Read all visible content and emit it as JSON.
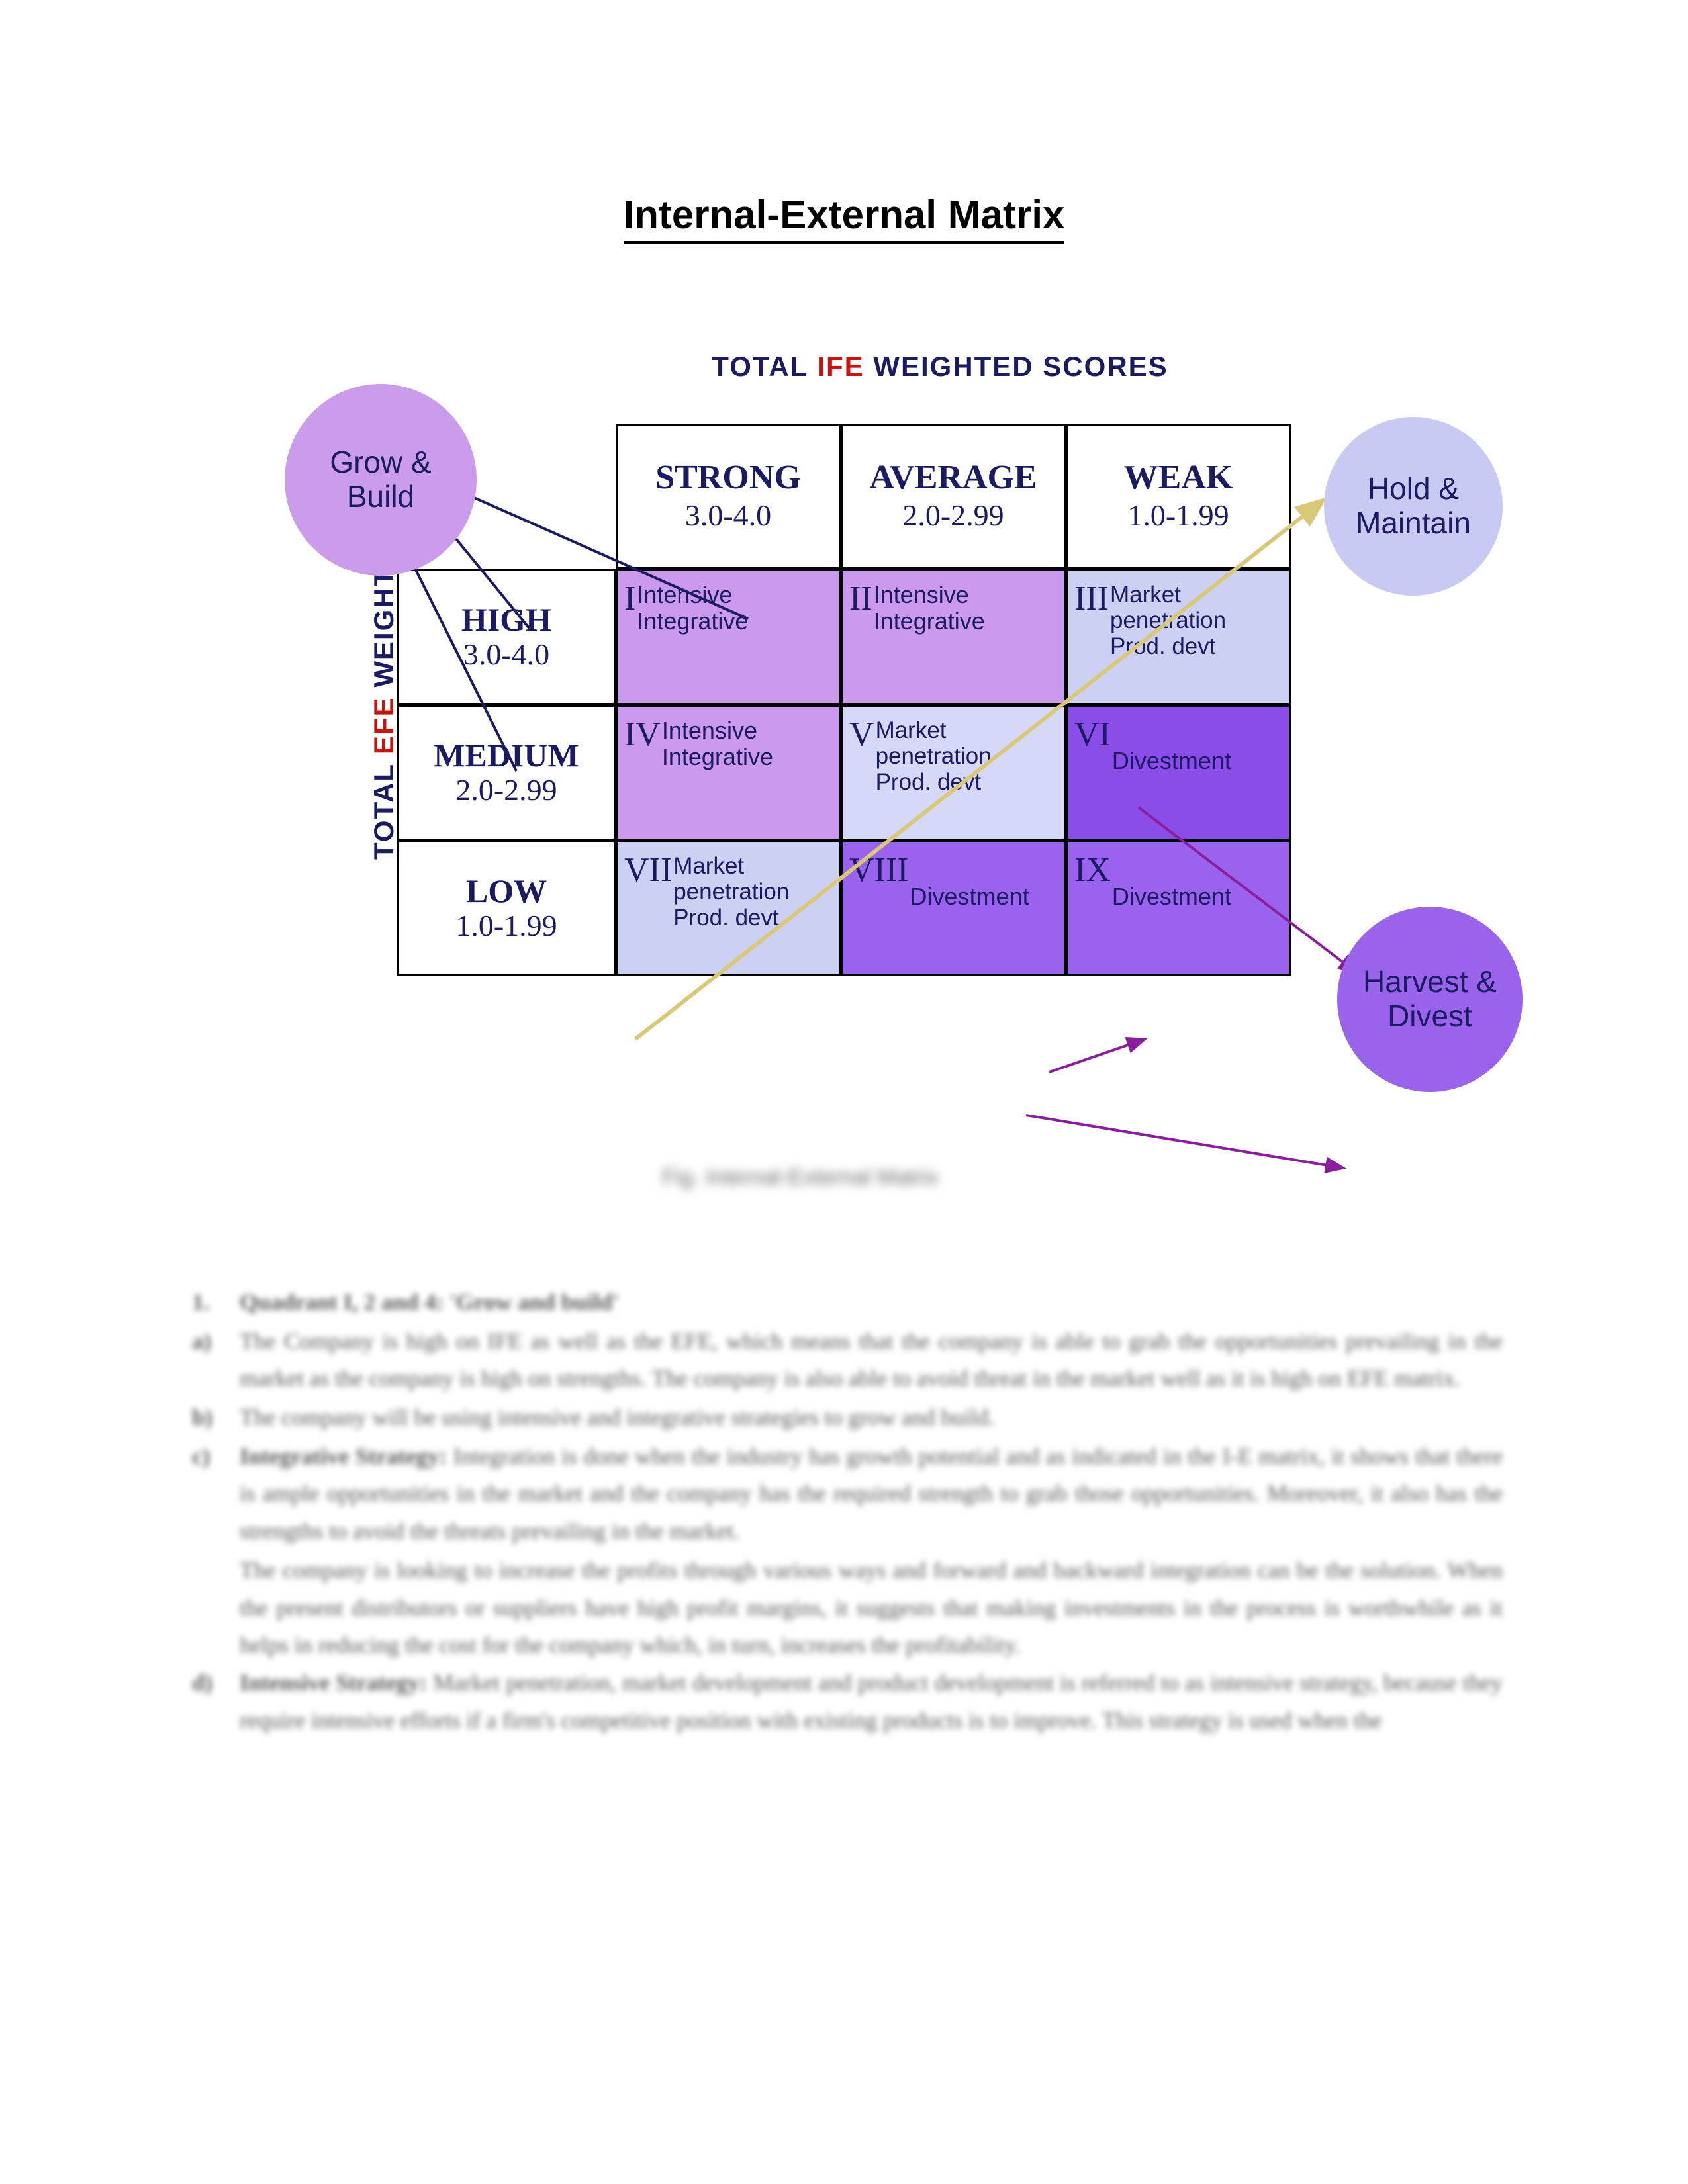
{
  "document": {
    "title": "Internal-External Matrix"
  },
  "figure": {
    "x_axis_label": {
      "prefix": "TOTAL ",
      "highlight": "IFE",
      "suffix": " WEIGHTED SCORES",
      "highlight_color": "#cc1111",
      "text_color": "#1b1b63"
    },
    "y_axis_label": {
      "prefix": "TOTAL ",
      "highlight": "EFE",
      "suffix": " WEIGHTED SCORES",
      "highlight_color": "#cc1111",
      "text_color": "#1b1b63"
    },
    "caption": "Fig. Internal-External Matrix",
    "columns": [
      {
        "name": "STRONG",
        "range": "3.0-4.0"
      },
      {
        "name": "AVERAGE",
        "range": "2.0-2.99"
      },
      {
        "name": "WEAK",
        "range": "1.0-1.99"
      }
    ],
    "rows": [
      {
        "name": "HIGH",
        "range": "3.0-4.0"
      },
      {
        "name": "MEDIUM",
        "range": "2.0-2.99"
      },
      {
        "name": "LOW",
        "range": "1.0-1.99"
      }
    ],
    "cells": [
      {
        "numeral": "I",
        "strategy": "Intensive\nIntegrative",
        "color": "#cc99f0"
      },
      {
        "numeral": "II",
        "strategy": "Intensive\nIntegrative",
        "color": "#cc99f0"
      },
      {
        "numeral": "III",
        "strategy": "Market\npenetration\nProd. devt",
        "color": "#ccd0f2"
      },
      {
        "numeral": "IV",
        "strategy": "Intensive\nIntegrative",
        "color": "#cc99f0"
      },
      {
        "numeral": "V",
        "strategy": "Market\npenetration\nProd. devt",
        "color": "#d5d8f7"
      },
      {
        "numeral": "VI",
        "strategy": "Divestment",
        "color": "#8b4dea"
      },
      {
        "numeral": "VII",
        "strategy": "Market\npenetration\nProd. devt",
        "color": "#ccd0f2"
      },
      {
        "numeral": "VIII",
        "strategy": "Divestment",
        "color": "#9a63ee"
      },
      {
        "numeral": "IX",
        "strategy": "Divestment",
        "color": "#9a63ee"
      }
    ],
    "circles": [
      {
        "id": "grow",
        "label": "Grow &\nBuild",
        "color": "#cb9cec"
      },
      {
        "id": "hold",
        "label": "Hold &\nMaintain",
        "color": "#c9caf3"
      },
      {
        "id": "harvest",
        "label": "Harvest &\nDivest",
        "color": "#9a63ec"
      }
    ],
    "arrow_colors": {
      "grow": "#1b1b63",
      "hold": "#d8c878",
      "harvest": "#8a1f9e"
    }
  },
  "body": {
    "items": [
      {
        "marker": "1.",
        "bold": "Quadrant I, 2 and 4: 'Grow and build'",
        "text": ""
      },
      {
        "marker": "a)",
        "bold": "",
        "text": "The Company is high on IFE as well as the EFE, which means that the company is able to grab the opportunities prevailing in the market as the company is high on strengths. The company is also able to avoid threat in the market well as it is high on EFE matrix."
      },
      {
        "marker": "b)",
        "bold": "",
        "text": "The company will be using intensive and integrative strategies to grow and build."
      },
      {
        "marker": "c)",
        "bold": "Integrative Strategy:",
        "text": "Integration is done when the industry has growth potential and as indicated in the I-E matrix, it shows that there is ample opportunities in the market and the company has the required strength to grab those opportunities. Moreover, it also has the strengths to avoid the threats prevailing in the market."
      },
      {
        "marker": "",
        "bold": "",
        "text": "The company is looking to increase the profits through various ways and forward and backward integration can be the solution. When the present distributors or suppliers have high profit margins, it suggests that making investments in the process is worthwhile as it helps in reducing the cost for the company which, in turn, increases the profitability."
      },
      {
        "marker": "d)",
        "bold": "Intensive Strategy:",
        "text": "Market penetration, market development and product development is referred to as intensive strategy, because they require intensive efforts if a firm's competitive position with existing products is to improve. This strategy is used when the"
      }
    ]
  }
}
